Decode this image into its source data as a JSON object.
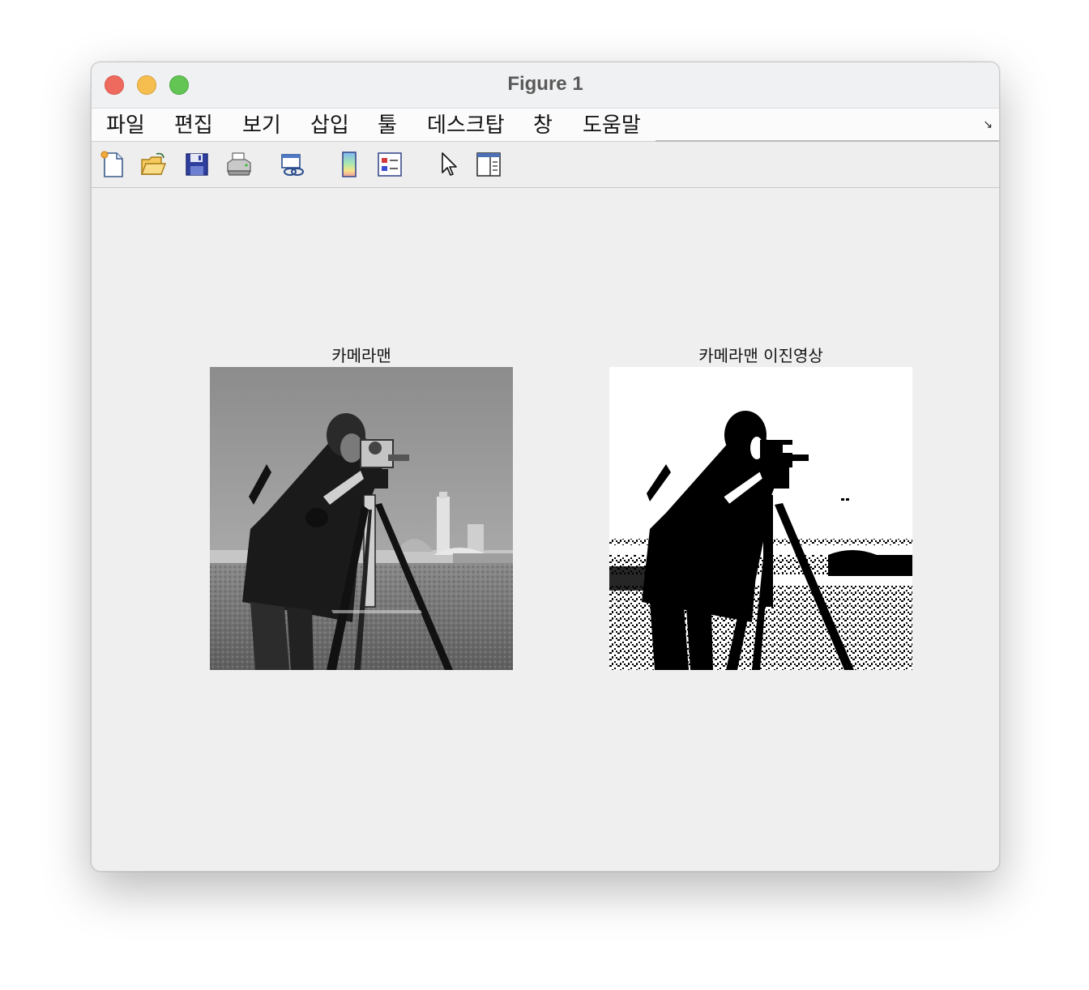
{
  "window": {
    "title": "Figure 1"
  },
  "menu": {
    "items": [
      "파일",
      "편집",
      "보기",
      "삽입",
      "툴",
      "데스크탑",
      "창",
      "도움말"
    ],
    "dock_icon": "undock-arrow-icon"
  },
  "toolbar": {
    "tools": [
      {
        "name": "new-figure-icon"
      },
      {
        "name": "open-file-icon"
      },
      {
        "name": "save-icon"
      },
      {
        "name": "print-icon"
      },
      {
        "name": "link-plot-icon"
      },
      {
        "name": "insert-colorbar-icon"
      },
      {
        "name": "insert-legend-icon"
      },
      {
        "name": "edit-plot-cursor-icon"
      },
      {
        "name": "property-inspector-icon"
      }
    ]
  },
  "figure": {
    "axes": [
      {
        "title": "카메라맨",
        "image": "cameraman-grayscale"
      },
      {
        "title": "카메라맨 이진영상",
        "image": "cameraman-binary"
      }
    ]
  }
}
